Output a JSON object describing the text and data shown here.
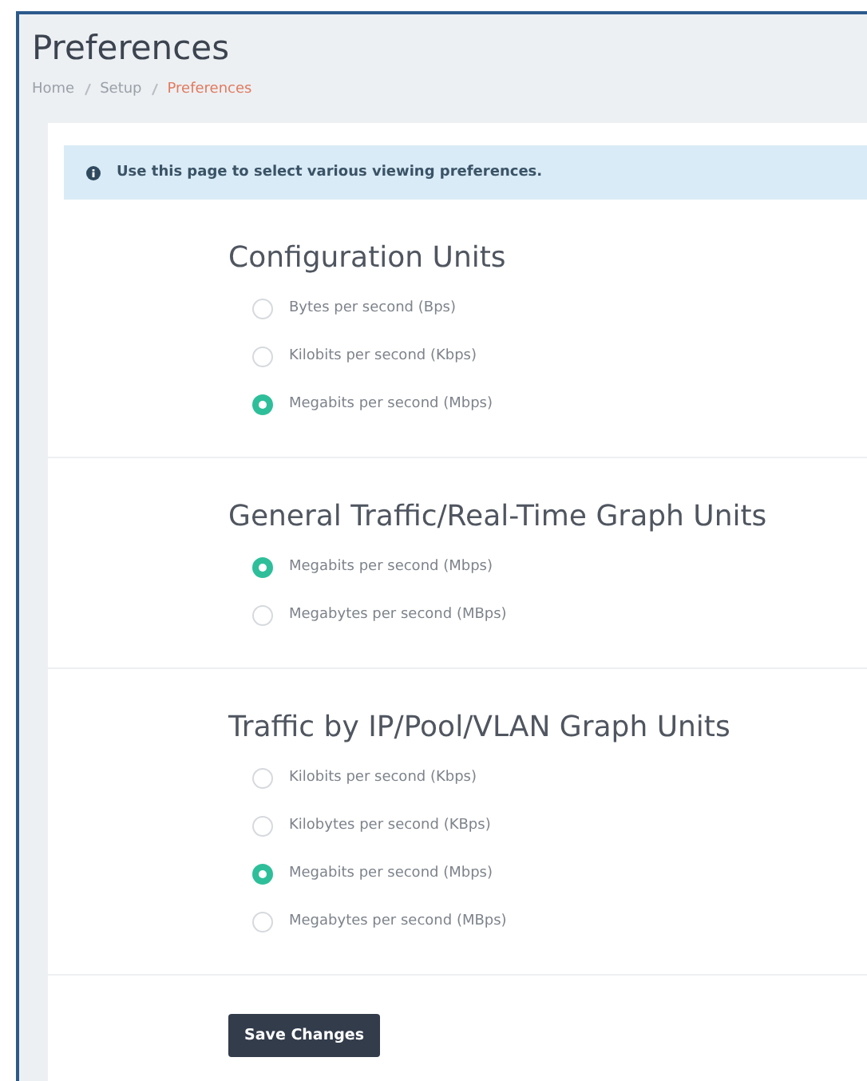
{
  "page": {
    "title": "Preferences"
  },
  "breadcrumb": [
    {
      "label": "Home",
      "current": false
    },
    {
      "label": "Setup",
      "current": false
    },
    {
      "label": "Preferences",
      "current": true
    }
  ],
  "info": {
    "text": "Use this page to select various viewing preferences."
  },
  "sections": [
    {
      "title": "Configuration Units",
      "options": [
        {
          "label": "Bytes per second (Bps)",
          "selected": false
        },
        {
          "label": "Kilobits per second (Kbps)",
          "selected": false
        },
        {
          "label": "Megabits per second (Mbps)",
          "selected": true
        }
      ]
    },
    {
      "title": "General Traffic/Real-Time Graph Units",
      "options": [
        {
          "label": "Megabits per second (Mbps)",
          "selected": true
        },
        {
          "label": "Megabytes per second (MBps)",
          "selected": false
        }
      ]
    },
    {
      "title": "Traffic by IP/Pool/VLAN Graph Units",
      "options": [
        {
          "label": "Kilobits per second (Kbps)",
          "selected": false
        },
        {
          "label": "Kilobytes per second (KBps)",
          "selected": false
        },
        {
          "label": "Megabits per second (Mbps)",
          "selected": true
        },
        {
          "label": "Megabytes per second (MBps)",
          "selected": false
        }
      ]
    }
  ],
  "save_button": {
    "label": "Save Changes"
  }
}
